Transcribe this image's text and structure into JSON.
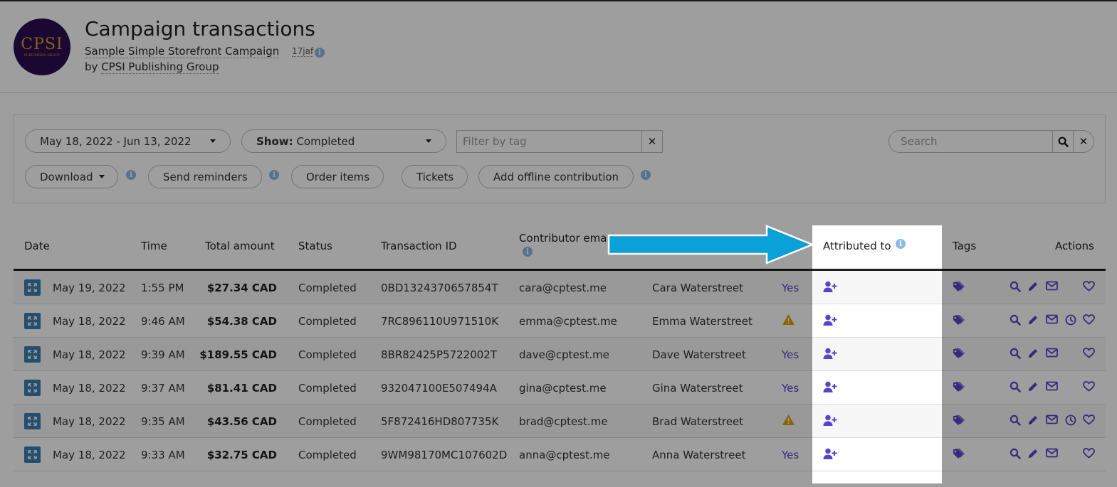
{
  "header": {
    "title": "Campaign transactions",
    "campaign_name": "Sample Simple Storefront Campaign",
    "campaign_code": "17jaf",
    "by_prefix": "by",
    "organization": "CPSI Publishing Group",
    "logo_text": "CPSI",
    "logo_subtext": "PUBLISHING GROUP"
  },
  "filters": {
    "date_range": "May 18, 2022 - Jun 13, 2022",
    "show_label": "Show:",
    "show_value": "Completed",
    "tag_placeholder": "Filter by tag",
    "search_placeholder": "Search",
    "download_label": "Download",
    "send_reminders_label": "Send reminders",
    "order_items_label": "Order items",
    "tickets_label": "Tickets",
    "add_offline_label": "Add offline contribution"
  },
  "table": {
    "columns": {
      "date": "Date",
      "time": "Time",
      "total": "Total amount",
      "status": "Status",
      "transaction_id": "Transaction ID",
      "contributor_email": "Contributor ema",
      "attributed_to": "Attributed to",
      "tags": "Tags",
      "actions": "Actions"
    },
    "rows": [
      {
        "date": "May 19, 2022",
        "time": "1:55 PM",
        "amount": "$27.34 CAD",
        "status": "Completed",
        "txn": "0BD1324370657854T",
        "email": "cara@cptest.me",
        "name": "Cara Waterstreet",
        "receipt": "Yes",
        "warning": false,
        "has_clock": false
      },
      {
        "date": "May 18, 2022",
        "time": "9:46 AM",
        "amount": "$54.38 CAD",
        "status": "Completed",
        "txn": "7RC896110U971510K",
        "email": "emma@cptest.me",
        "name": "Emma Waterstreet",
        "receipt": "",
        "warning": true,
        "has_clock": true
      },
      {
        "date": "May 18, 2022",
        "time": "9:39 AM",
        "amount": "$189.55 CAD",
        "status": "Completed",
        "txn": "8BR82425P5722002T",
        "email": "dave@cptest.me",
        "name": "Dave Waterstreet",
        "receipt": "Yes",
        "warning": false,
        "has_clock": false
      },
      {
        "date": "May 18, 2022",
        "time": "9:37 AM",
        "amount": "$81.41 CAD",
        "status": "Completed",
        "txn": "932047100E507494A",
        "email": "gina@cptest.me",
        "name": "Gina Waterstreet",
        "receipt": "Yes",
        "warning": false,
        "has_clock": false
      },
      {
        "date": "May 18, 2022",
        "time": "9:35 AM",
        "amount": "$43.56 CAD",
        "status": "Completed",
        "txn": "5F872416HD807735K",
        "email": "brad@cptest.me",
        "name": "Brad Waterstreet",
        "receipt": "",
        "warning": true,
        "has_clock": true
      },
      {
        "date": "May 18, 2022",
        "time": "9:33 AM",
        "amount": "$32.75 CAD",
        "status": "Completed",
        "txn": "9WM98170MC107602D",
        "email": "anna@cptest.me",
        "name": "Anna Waterstreet",
        "receipt": "Yes",
        "warning": false,
        "has_clock": false
      }
    ]
  },
  "colors": {
    "accent_purple": "#5a43c9",
    "arrow_blue": "#0aa0d8",
    "expand_blue": "#3c7fb0",
    "warning": "#e0a000"
  },
  "icons": {
    "row_expand": "expand-icon",
    "attribute": "user-plus-icon",
    "tags": "tags-icon",
    "actions": [
      "search-icon",
      "pencil-icon",
      "envelope-icon",
      "clock-icon",
      "heart-icon"
    ],
    "warning": "warning-icon",
    "info": "info-icon"
  }
}
